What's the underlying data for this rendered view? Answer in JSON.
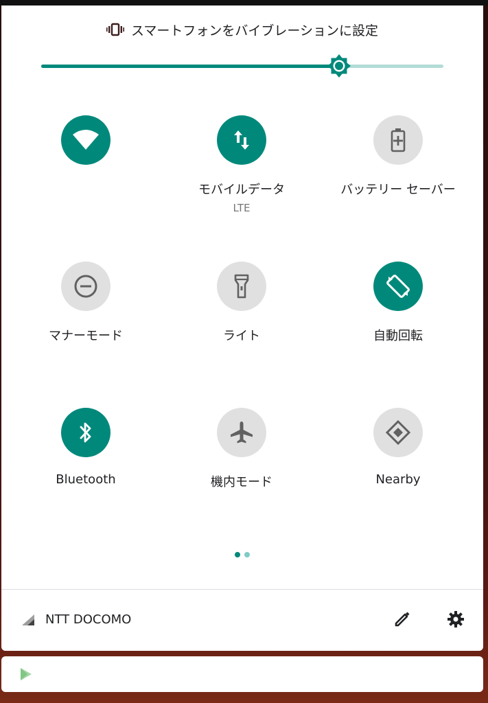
{
  "vibrate": {
    "text": "スマートフォンをバイブレーションに設定",
    "icon": "vibrate-icon"
  },
  "brightness": {
    "level_percent": 74,
    "icon": "brightness-icon"
  },
  "colors": {
    "accent": "#00897b",
    "track": "#b3dcd6",
    "inactive": "#e0e0e0"
  },
  "tiles": [
    {
      "id": "wifi",
      "label": "",
      "sub": "",
      "active": true,
      "icon": "wifi-icon"
    },
    {
      "id": "mobile-data",
      "label": "モバイルデータ",
      "sub": "LTE",
      "active": true,
      "icon": "mobile-data-icon"
    },
    {
      "id": "battery-saver",
      "label": "バッテリー セーバー",
      "sub": "",
      "active": false,
      "icon": "battery-saver-icon"
    },
    {
      "id": "do-not-disturb",
      "label": "マナーモード",
      "sub": "",
      "active": false,
      "icon": "do-not-disturb-icon"
    },
    {
      "id": "flashlight",
      "label": "ライト",
      "sub": "",
      "active": false,
      "icon": "flashlight-icon"
    },
    {
      "id": "auto-rotate",
      "label": "自動回転",
      "sub": "",
      "active": true,
      "icon": "auto-rotate-icon"
    },
    {
      "id": "bluetooth",
      "label": "Bluetooth",
      "sub": "",
      "active": true,
      "icon": "bluetooth-icon"
    },
    {
      "id": "airplane",
      "label": "機内モード",
      "sub": "",
      "active": false,
      "icon": "airplane-icon"
    },
    {
      "id": "nearby",
      "label": "Nearby",
      "sub": "",
      "active": false,
      "icon": "nearby-icon"
    }
  ],
  "page_indicator": {
    "current": 1,
    "total": 2
  },
  "footer": {
    "carrier": "NTT DOCOMO",
    "signal_icon": "signal-icon",
    "edit_icon": "edit-icon",
    "settings_icon": "settings-icon"
  },
  "notification": {
    "icon": "play-store-icon"
  }
}
